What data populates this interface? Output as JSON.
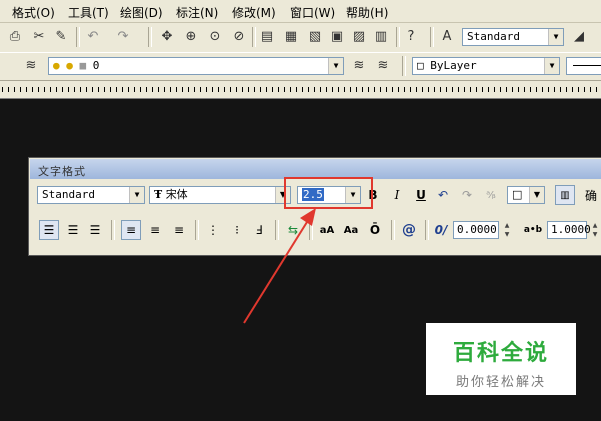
{
  "menu": [
    "格式(O)",
    "工具(T)",
    "绘图(D)",
    "标注(N)",
    "修改(M)",
    "窗口(W)",
    "帮助(H)"
  ],
  "toolbar1": {
    "text_style": "Standard"
  },
  "toolbar2": {
    "layer": "0",
    "color": "ByLayer"
  },
  "text_format": {
    "title": "文字格式",
    "style": "Standard",
    "font": "宋体",
    "height": "2.5",
    "bold": "B",
    "italic": "I",
    "underline": "U",
    "ok_label": "确",
    "oblique_value": "0.0000",
    "width_value": "1.0000",
    "at_symbol": "@",
    "oblique_icon": "0/",
    "tracking_icon": "a•b",
    "upper_icon": "aA",
    "lower_icon": "Aa",
    "overline_icon": "Ō"
  },
  "watermark": {
    "title": "百科全说",
    "subtitle": "助你轻松解决"
  },
  "colors": {
    "canvas": "#141414",
    "highlight": "#e0382e",
    "watermark_green": "#2eab3d"
  }
}
